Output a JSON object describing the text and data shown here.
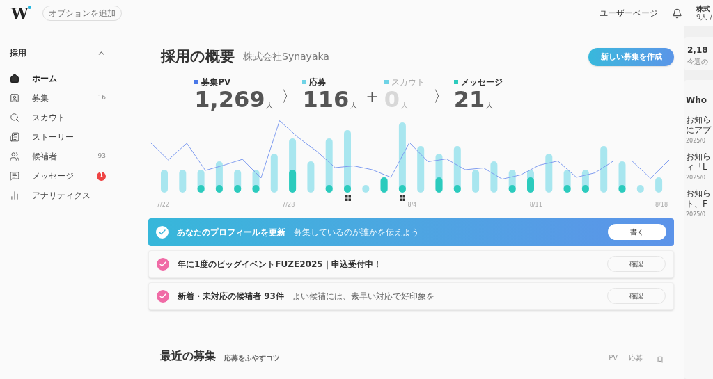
{
  "header": {
    "logo": "W",
    "option_button": "オプションを追加",
    "user_page_link": "ユーザーページ",
    "company": "株式",
    "members": "9人 /"
  },
  "sidebar": {
    "section": {
      "label": "採用",
      "expanded": true
    },
    "items": [
      {
        "label": "ホーム",
        "selected": true
      },
      {
        "label": "募集",
        "count": "16",
        "selected": false
      },
      {
        "label": "スカウト",
        "selected": false
      },
      {
        "label": "ストーリー",
        "selected": false
      },
      {
        "label": "候補者",
        "count": "93",
        "selected": false
      },
      {
        "label": "メッセージ",
        "badge": "1",
        "selected": false
      },
      {
        "label": "アナリティクス",
        "selected": false
      }
    ]
  },
  "main": {
    "title": "採用の概要",
    "company": "株式会社Synayaka",
    "create_button": "新しい募集を作成",
    "funnel": [
      {
        "label": "募集PV",
        "value": "1,269",
        "unit": "人",
        "color": "#4a78e8",
        "muted": false
      },
      {
        "prefix": "〉",
        "label": "応募",
        "value": "116",
        "unit": "人",
        "color": "#6fd3e6",
        "muted": false
      },
      {
        "prefix": "+",
        "label": "スカウト",
        "value": "0",
        "unit": "人",
        "color": "#6fd3e6",
        "muted": true
      },
      {
        "prefix": "〉",
        "label": "メッセージ",
        "value": "21",
        "unit": "人",
        "color": "#2ccbbd",
        "muted": false
      }
    ],
    "chart": {
      "date_labels": [
        "7/22",
        "7/28",
        "8/4",
        "8/11",
        "8/18"
      ]
    },
    "tasks": [
      {
        "title": "あなたのプロフィールを更新",
        "note": "募集しているのが誰かを伝えよう",
        "button": "書く",
        "highlighted": true
      },
      {
        "title": "年に1度のビッグイベントFUZE2025｜申込受付中！",
        "button": "確認",
        "highlighted": false
      },
      {
        "title": "新着・未対応の候補者 93件",
        "note": "よい候補には、素早い対応で好印象を",
        "button": "確認",
        "highlighted": false
      }
    ],
    "recent": {
      "title": "最近の募集",
      "tip_link": "応募をふやすコツ",
      "columns": [
        "PV",
        "応募"
      ]
    }
  },
  "right_panel": {
    "stat_value": "2,18",
    "stat_label": "今週の",
    "news_title": "Who",
    "news": [
      {
        "line1": "お知ら",
        "line2": "にアプ",
        "date": "2025/0"
      },
      {
        "line1": "お知ら",
        "line2": "ィ「L",
        "date": "2025/0"
      },
      {
        "line1": "お知ら",
        "line2": "ト、F",
        "date": "2025/0"
      }
    ]
  }
}
